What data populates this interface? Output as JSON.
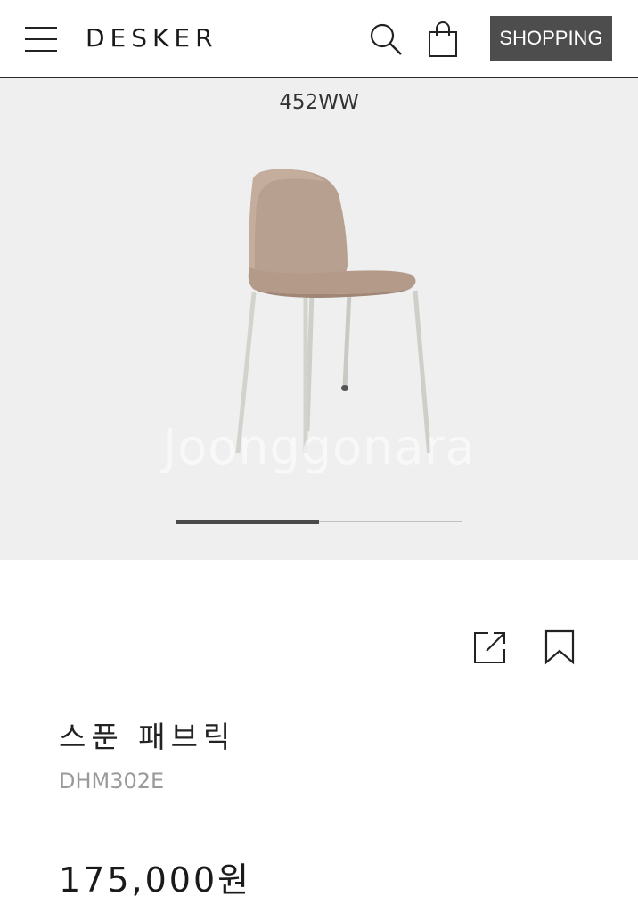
{
  "header": {
    "logo": "DESKER",
    "shopping_label": "SHOPPING",
    "menu_icon": "menu-icon",
    "search_icon": "search-icon",
    "bag_icon": "shopping-bag-icon"
  },
  "gallery": {
    "model_label": "452WW",
    "watermark": "Joonggonara",
    "progress_fraction": 0.5
  },
  "actions": {
    "share_icon": "share-icon",
    "bookmark_icon": "bookmark-icon"
  },
  "product": {
    "name": "스푼 패브릭",
    "code": "DHM302E",
    "price": "175,000원"
  },
  "colors": {
    "shopping_button_bg": "#4d4d4d",
    "hero_bg": "#efefef",
    "chair_fabric": "#b59a89",
    "chair_legs": "#cfcfca"
  }
}
